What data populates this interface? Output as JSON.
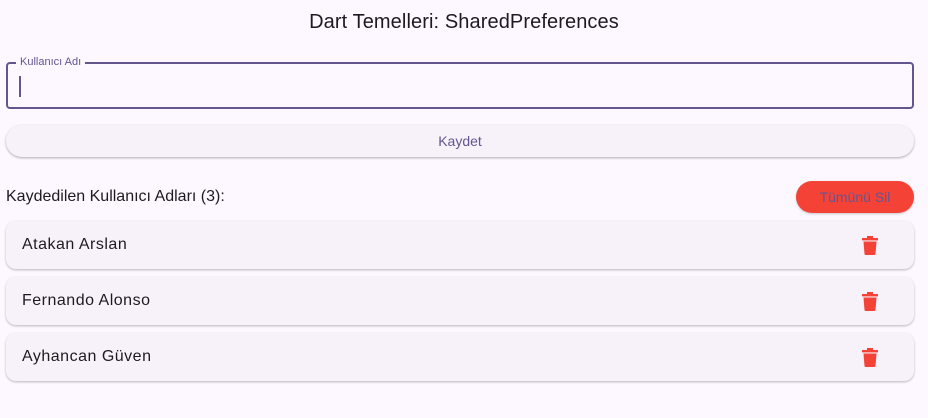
{
  "app_bar": {
    "title": "Dart Temelleri: SharedPreferences"
  },
  "form": {
    "username_label": "Kullanıcı Adı",
    "username_value": "",
    "save_label": "Kaydet"
  },
  "list": {
    "title": "Kaydedilen Kullanıcı Adları (3):",
    "delete_all_label": "Tümünü Sil",
    "items": [
      {
        "name": "Atakan Arslan",
        "icon": "trash-icon"
      },
      {
        "name": "Fernando Alonso",
        "icon": "trash-icon"
      },
      {
        "name": "Ayhancan Güven",
        "icon": "trash-icon"
      }
    ]
  },
  "colors": {
    "background": "#fdf7ff",
    "primary": "#65558f",
    "danger": "#f44336",
    "surface": "#f7f2fa"
  }
}
